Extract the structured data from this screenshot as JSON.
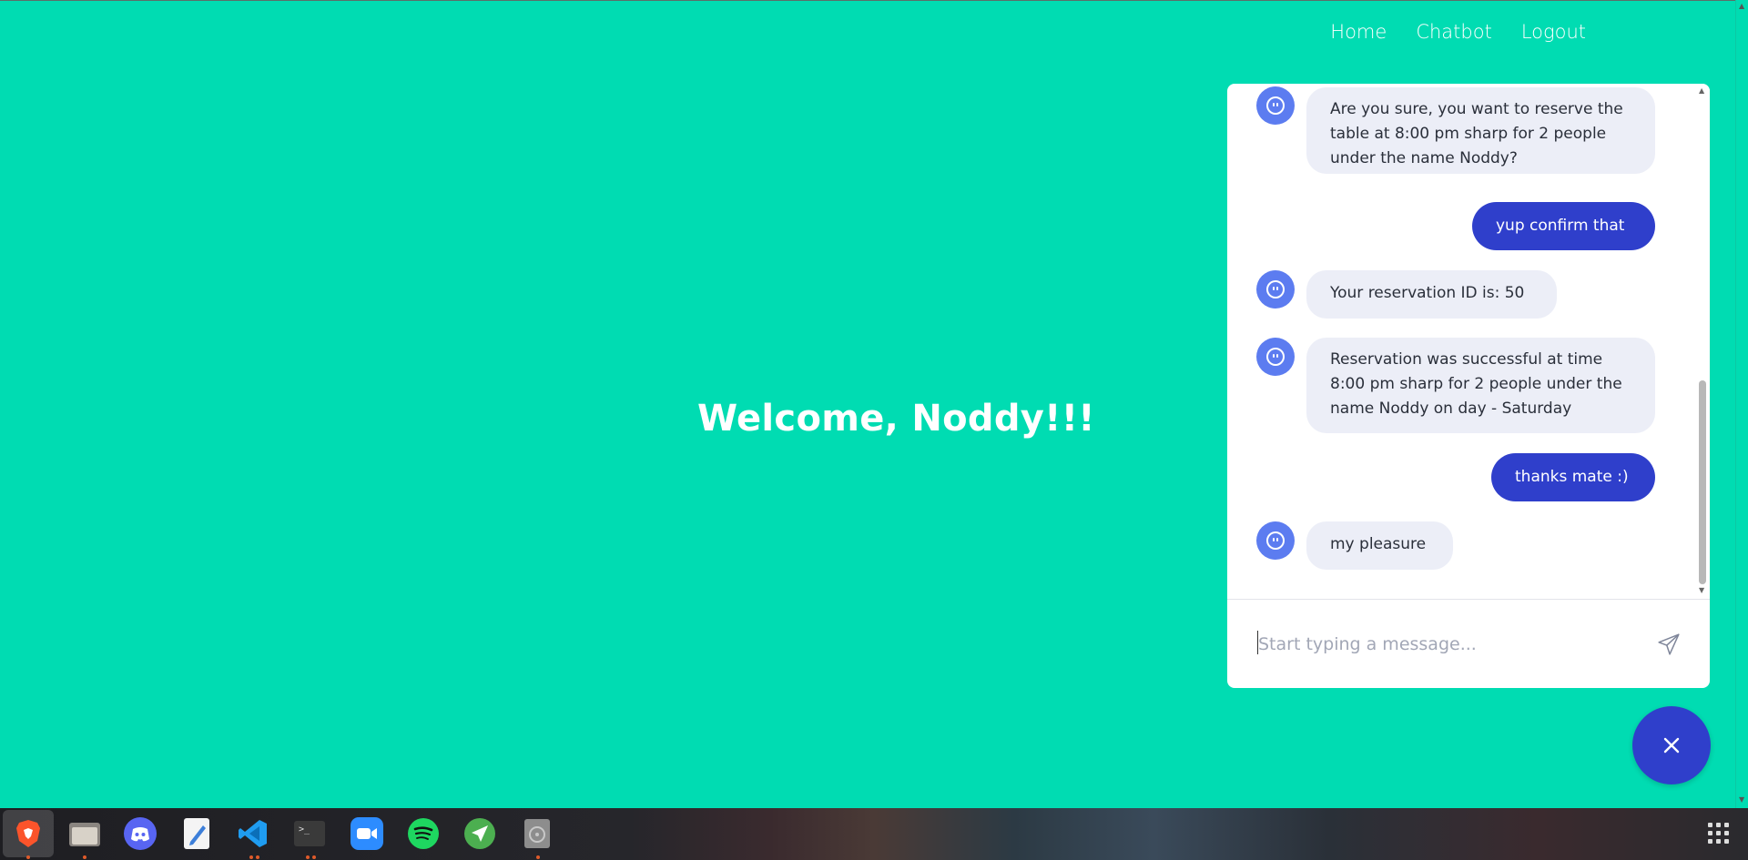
{
  "nav": {
    "home": "Home",
    "chatbot": "Chatbot",
    "logout": "Logout"
  },
  "welcome": "Welcome, Noddy!!!",
  "chat": {
    "messages": [
      {
        "from": "bot",
        "text": "Are you sure, you want to reserve the table at 8:00 pm sharp for 2 people under the name Noddy?"
      },
      {
        "from": "user",
        "text": "yup confirm that"
      },
      {
        "from": "bot",
        "text": "Your reservation ID is: 50"
      },
      {
        "from": "bot",
        "text": "Reservation was successful at time 8:00 pm sharp for 2 people under the name Noddy on day - Saturday"
      },
      {
        "from": "user",
        "text": "thanks mate :)"
      },
      {
        "from": "bot",
        "text": "my pleasure"
      }
    ],
    "input_placeholder": "Start typing a message..."
  },
  "taskbar": {
    "apps": [
      "brave-browser",
      "files",
      "discord",
      "text-editor",
      "vscode",
      "terminal",
      "zoom",
      "spotify",
      "send-app",
      "disk-utility"
    ]
  },
  "colors": {
    "page_bg": "#00dcb2",
    "accent": "#2f3fcb",
    "bot_avatar": "#5c7cf0",
    "bot_bubble": "#eceef7"
  }
}
